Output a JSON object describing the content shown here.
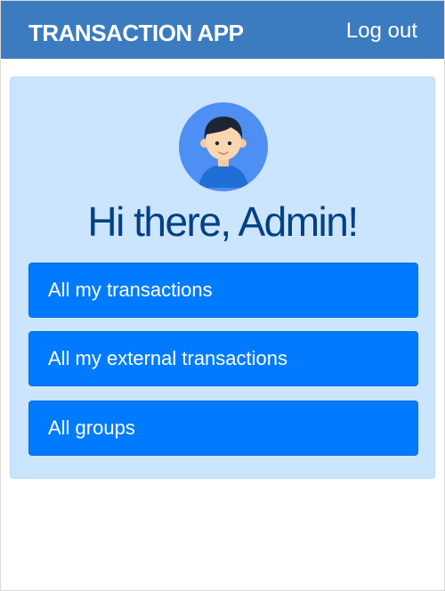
{
  "header": {
    "brand": "TRANSACTION APP",
    "logout_label": "Log out"
  },
  "main": {
    "avatar_icon": "user-avatar-icon",
    "greeting": "Hi there, Admin!",
    "buttons": [
      {
        "label": "All my transactions"
      },
      {
        "label": "All my external transactions"
      },
      {
        "label": "All groups"
      }
    ]
  },
  "colors": {
    "navbar": "#3b7bc0",
    "card_background": "#cce5ff",
    "greeting_text": "#004085",
    "button": "#007bff"
  }
}
